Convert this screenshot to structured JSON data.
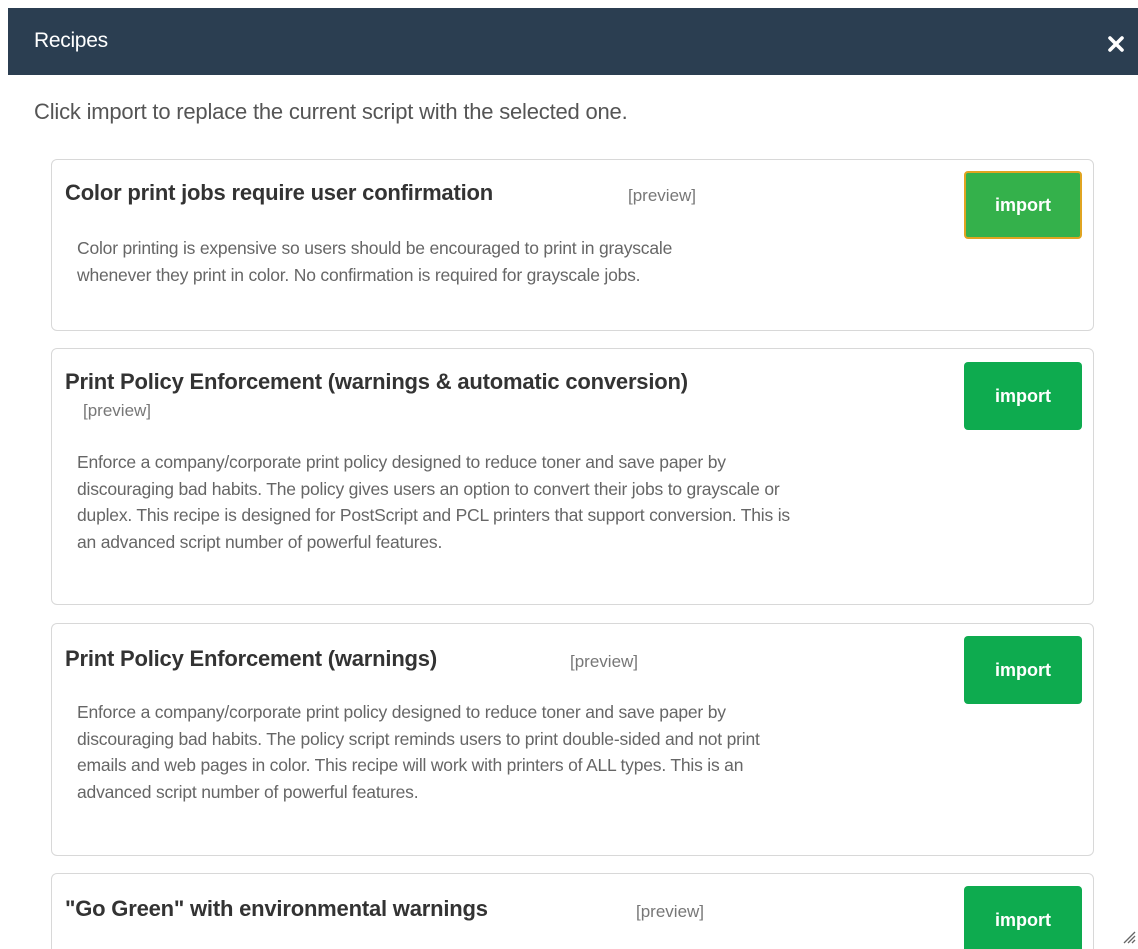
{
  "dialog": {
    "title": "Recipes",
    "close_icon": "close-icon",
    "intro": "Click import to replace the current script with the selected one."
  },
  "colors": {
    "titlebar": "#2b3e51",
    "import_button": "#0eab4f",
    "focus_ring": "#e0a421"
  },
  "recipes": [
    {
      "title": "Color print jobs require user confirmation",
      "preview": "[preview]",
      "description_lines": [
        "Color printing is expensive so users should be encouraged to print in grayscale",
        "whenever they print in color. No confirmation is required for grayscale jobs."
      ],
      "import_label": "import"
    },
    {
      "title": "Print Policy Enforcement (warnings & automatic conversion)",
      "preview": "[preview]",
      "description_lines": [
        "Enforce a company/corporate print policy designed to reduce toner and save paper by",
        "discouraging bad habits. The policy gives users an option to convert their jobs to grayscale or",
        "duplex. This recipe is designed for PostScript and PCL printers that support conversion. This is",
        "an advanced script number of powerful features."
      ],
      "import_label": "import"
    },
    {
      "title": "Print Policy Enforcement (warnings)",
      "preview": "[preview]",
      "description_lines": [
        "Enforce a company/corporate print policy designed to reduce toner and save paper by",
        "discouraging bad habits. The policy script reminds users to print double-sided and not print",
        "emails and web pages in color. This recipe will work with printers of ALL types. This is an",
        "advanced script number of powerful features."
      ],
      "import_label": "import"
    },
    {
      "title": "\"Go Green\" with environmental warnings",
      "preview": "[preview]",
      "import_label": "import"
    }
  ]
}
